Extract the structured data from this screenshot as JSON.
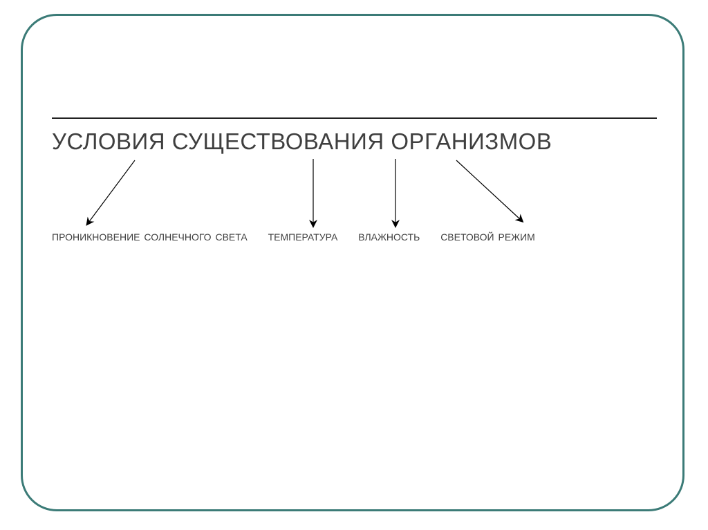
{
  "title": "УСЛОВИЯ СУЩЕСТВОВАНИЯ ОРГАНИЗМОВ",
  "items": {
    "a": "ПРОНИКНОВЕНИЕ СОЛНЕЧНОГО СВЕТА",
    "b": "ТЕМПЕРАТУРА",
    "c": "ВЛАЖНОСТЬ",
    "d": "СВЕТОВОЙ РЕЖИМ"
  },
  "colors": {
    "frame": "#3b7b77",
    "text": "#3f3f3f"
  }
}
